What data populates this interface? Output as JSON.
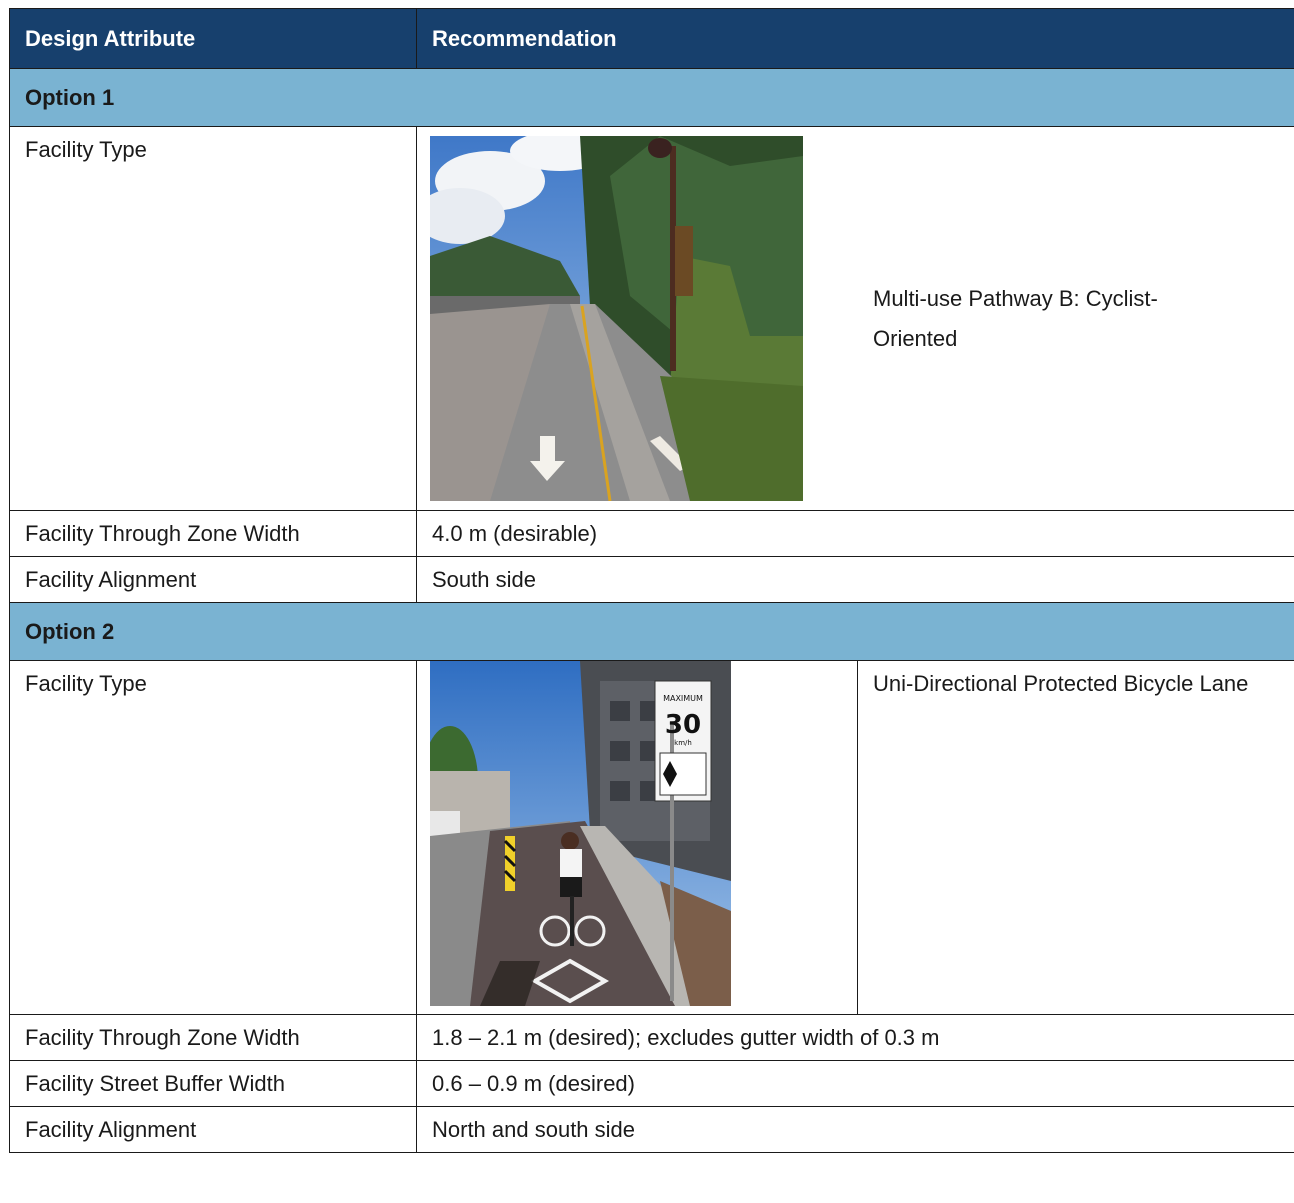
{
  "header": {
    "col1": "Design Attribute",
    "col2": "Recommendation"
  },
  "option1": {
    "title": "Option 1",
    "facility_type_label": "Facility Type",
    "facility_type_value": "Multi-use Pathway B: Cyclist-Oriented",
    "through_zone_label": "Facility Through Zone Width",
    "through_zone_value": "4.0 m (desirable)",
    "alignment_label": "Facility Alignment",
    "alignment_value": "South side"
  },
  "option2": {
    "title": "Option 2",
    "facility_type_label": "Facility Type",
    "facility_type_value": "Uni-Directional Protected Bicycle Lane",
    "sign_text_top": "MAXIMUM",
    "sign_speed": "30",
    "sign_unit": "km/h",
    "through_zone_label": "Facility Through Zone Width",
    "through_zone_value": "1.8 – 2.1 m (desired); excludes gutter width of 0.3 m",
    "buffer_label": "Facility Street Buffer Width",
    "buffer_value": "0.6 – 0.9 m (desired)",
    "alignment_label": "Facility Alignment",
    "alignment_value": "North and south side"
  },
  "colors": {
    "header_bg": "#17406d",
    "option_bg": "#7ab3d2",
    "border": "#1a1a1a"
  }
}
